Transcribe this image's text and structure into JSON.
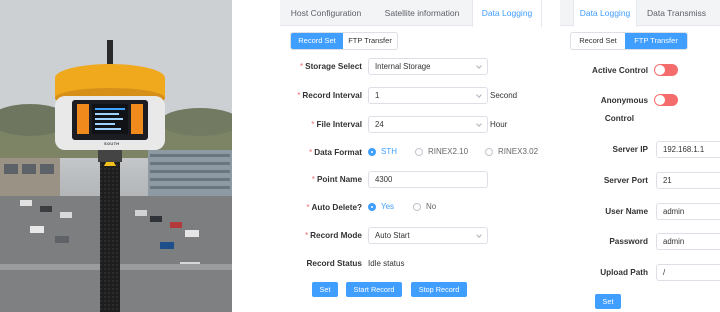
{
  "photo": {
    "receiver_brand": "SOUTH"
  },
  "panel_main": {
    "tabs": [
      "Host Configuration",
      "Satellite information",
      "Data Logging"
    ],
    "active_tab": "Data Logging",
    "subtabs": [
      "Record Set",
      "FTP Transfer"
    ],
    "active_subtab": "Record Set",
    "form": {
      "storage_select": {
        "label": "Storage Select",
        "value": "Internal Storage"
      },
      "record_interval": {
        "label": "Record Interval",
        "value": "1",
        "unit": "Second"
      },
      "file_interval": {
        "label": "File Interval",
        "value": "24",
        "unit": "Hour"
      },
      "data_format": {
        "label": "Data Format",
        "options": [
          "STH",
          "RINEX2.10",
          "RINEX3.02"
        ],
        "selected": "STH"
      },
      "point_name": {
        "label": "Point Name",
        "value": "4300"
      },
      "auto_delete": {
        "label": "Auto Delete?",
        "options": [
          "Yes",
          "No"
        ],
        "selected": "Yes"
      },
      "record_mode": {
        "label": "Record Mode",
        "value": "Auto Start"
      },
      "record_status": {
        "label": "Record Status",
        "value": "Idle status"
      }
    },
    "buttons": {
      "set": "Set",
      "start": "Start Record",
      "stop": "Stop Record"
    }
  },
  "panel_ftp": {
    "tabs": [
      "Data Logging",
      "Data Transmiss"
    ],
    "active_tab": "Data Logging",
    "subtabs": [
      "Record Set",
      "FTP Transfer"
    ],
    "active_subtab": "FTP Transfer",
    "active_control": {
      "label": "Active Control",
      "on": false
    },
    "anonymous_control": {
      "label_line1": "Anonymous",
      "label_line2": "Control",
      "on": false
    },
    "server_ip": {
      "label": "Server IP",
      "value": "192.168.1.1"
    },
    "server_port": {
      "label": "Server Port",
      "value": "21"
    },
    "user_name": {
      "label": "User Name",
      "value": "admin"
    },
    "password": {
      "label": "Password",
      "value": "admin"
    },
    "upload_path": {
      "label": "Upload Path",
      "value": "/"
    },
    "set_button": "Set"
  },
  "colors": {
    "accent": "#409eff",
    "required": "#f56c6c",
    "toggle_off": "#f56c6c",
    "receiver_yellow": "#f0a81c"
  }
}
